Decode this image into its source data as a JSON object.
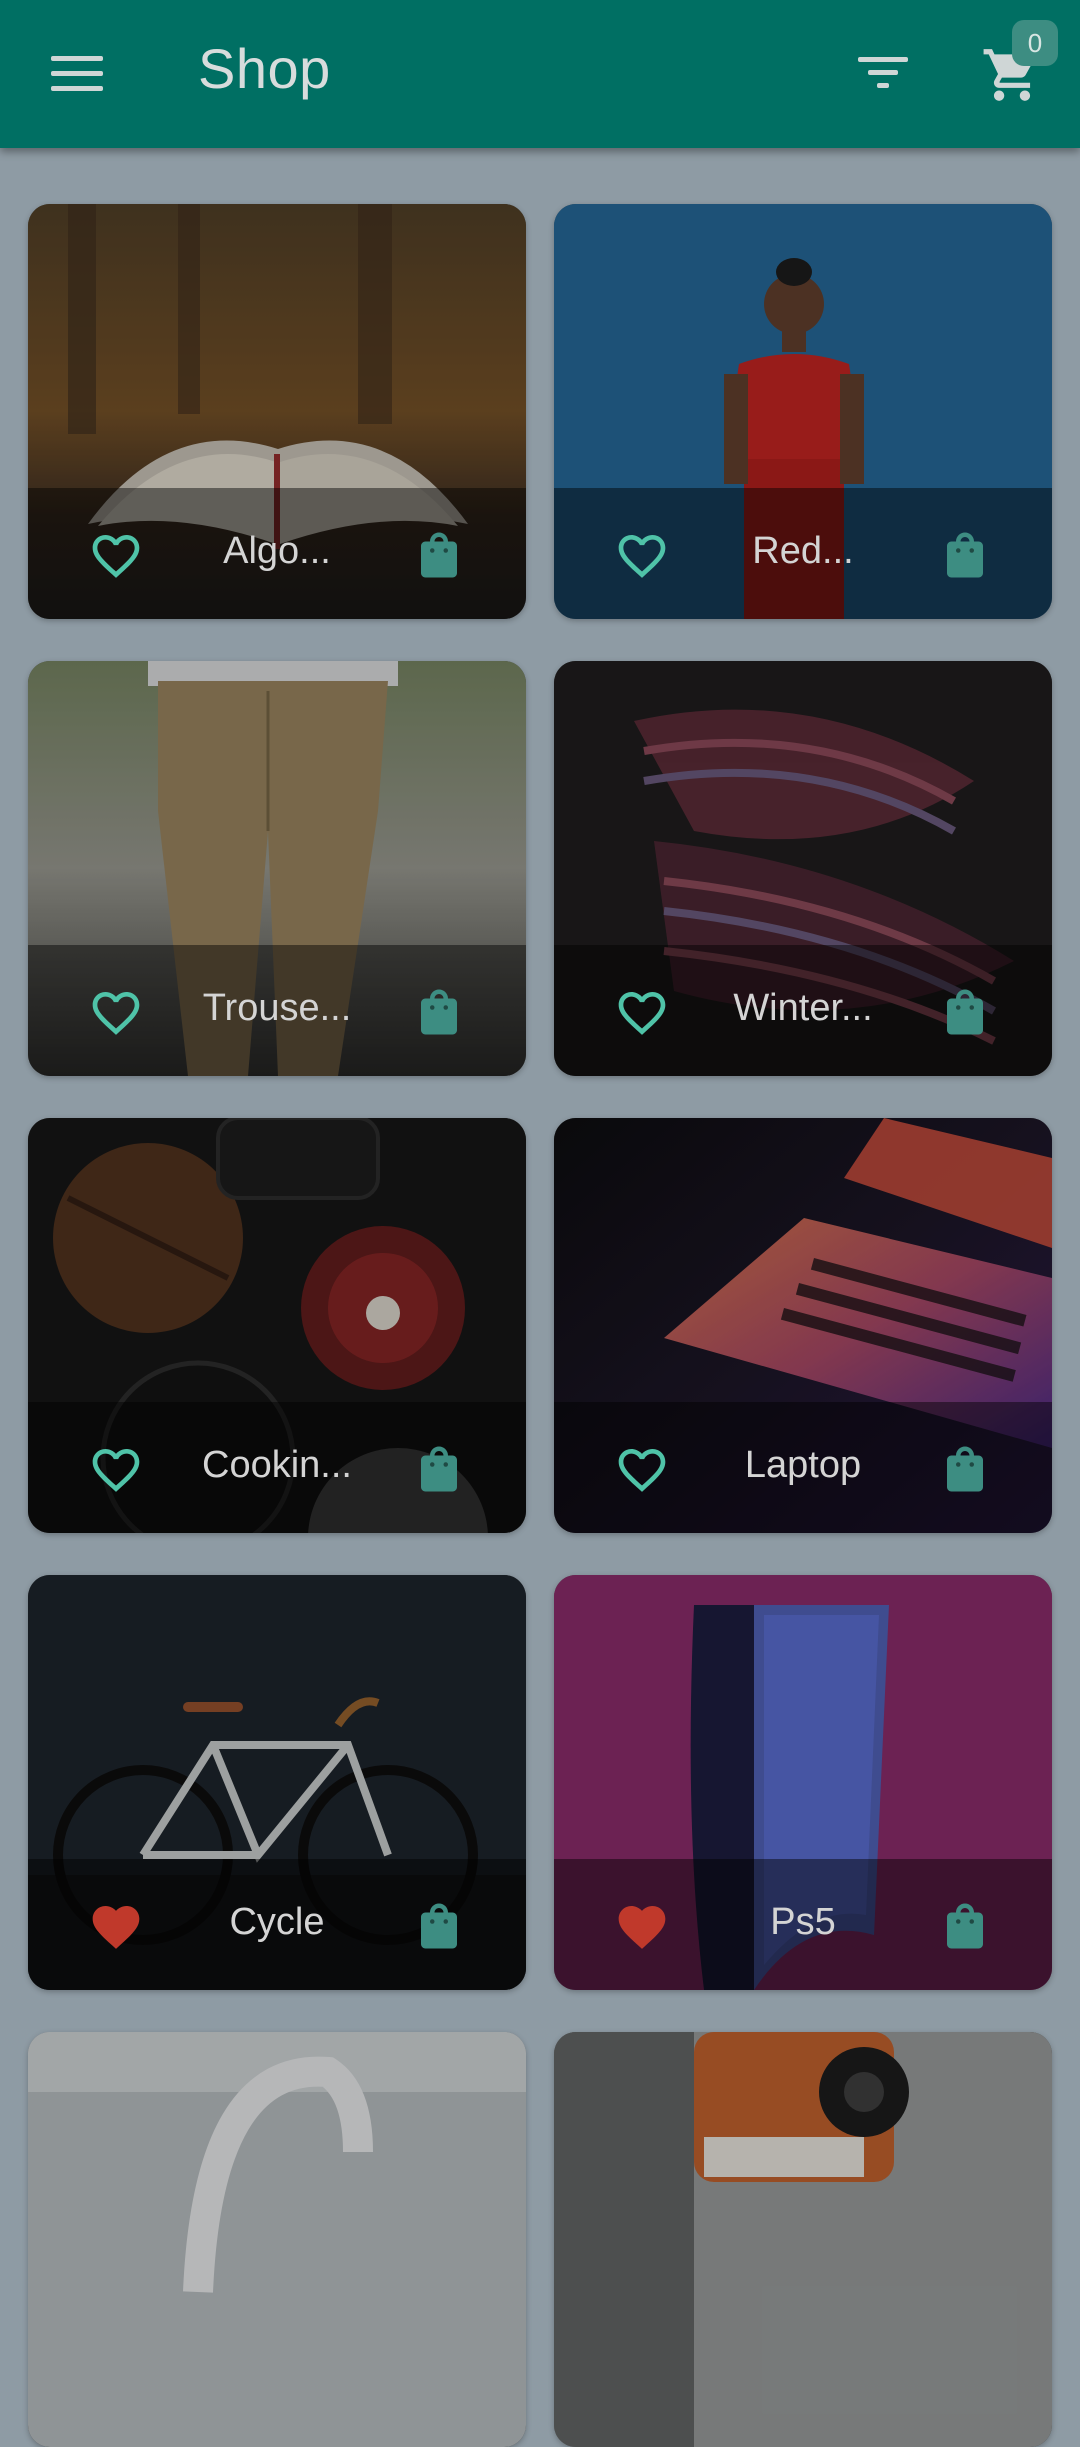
{
  "appbar": {
    "title": "Shop",
    "cart_count": "0",
    "menu_icon": "menu-icon",
    "filter_icon": "filter-icon",
    "cart_icon": "cart-icon"
  },
  "colors": {
    "primary": "#006f63",
    "accent": "#4fc3a8",
    "favorite_active": "#c0392b",
    "background": "#8e9ba4"
  },
  "products": [
    {
      "name": "Algo...",
      "favorite": false,
      "image": "open-book-photo"
    },
    {
      "name": "Red...",
      "favorite": false,
      "image": "person-red-shirt-photo"
    },
    {
      "name": "Trouse...",
      "favorite": false,
      "image": "trousers-photo"
    },
    {
      "name": "Winter...",
      "favorite": false,
      "image": "striped-scarf-photo"
    },
    {
      "name": "Cookin...",
      "favorite": false,
      "image": "cookware-photo"
    },
    {
      "name": "Laptop",
      "favorite": false,
      "image": "laptop-keyboard-photo"
    },
    {
      "name": "Cycle",
      "favorite": true,
      "image": "bicycle-photo"
    },
    {
      "name": "Ps5",
      "favorite": true,
      "image": "ps5-console-photo"
    },
    {
      "name": "",
      "favorite": false,
      "image": "headphones-photo"
    },
    {
      "name": "",
      "favorite": false,
      "image": "instant-camera-photo"
    }
  ]
}
